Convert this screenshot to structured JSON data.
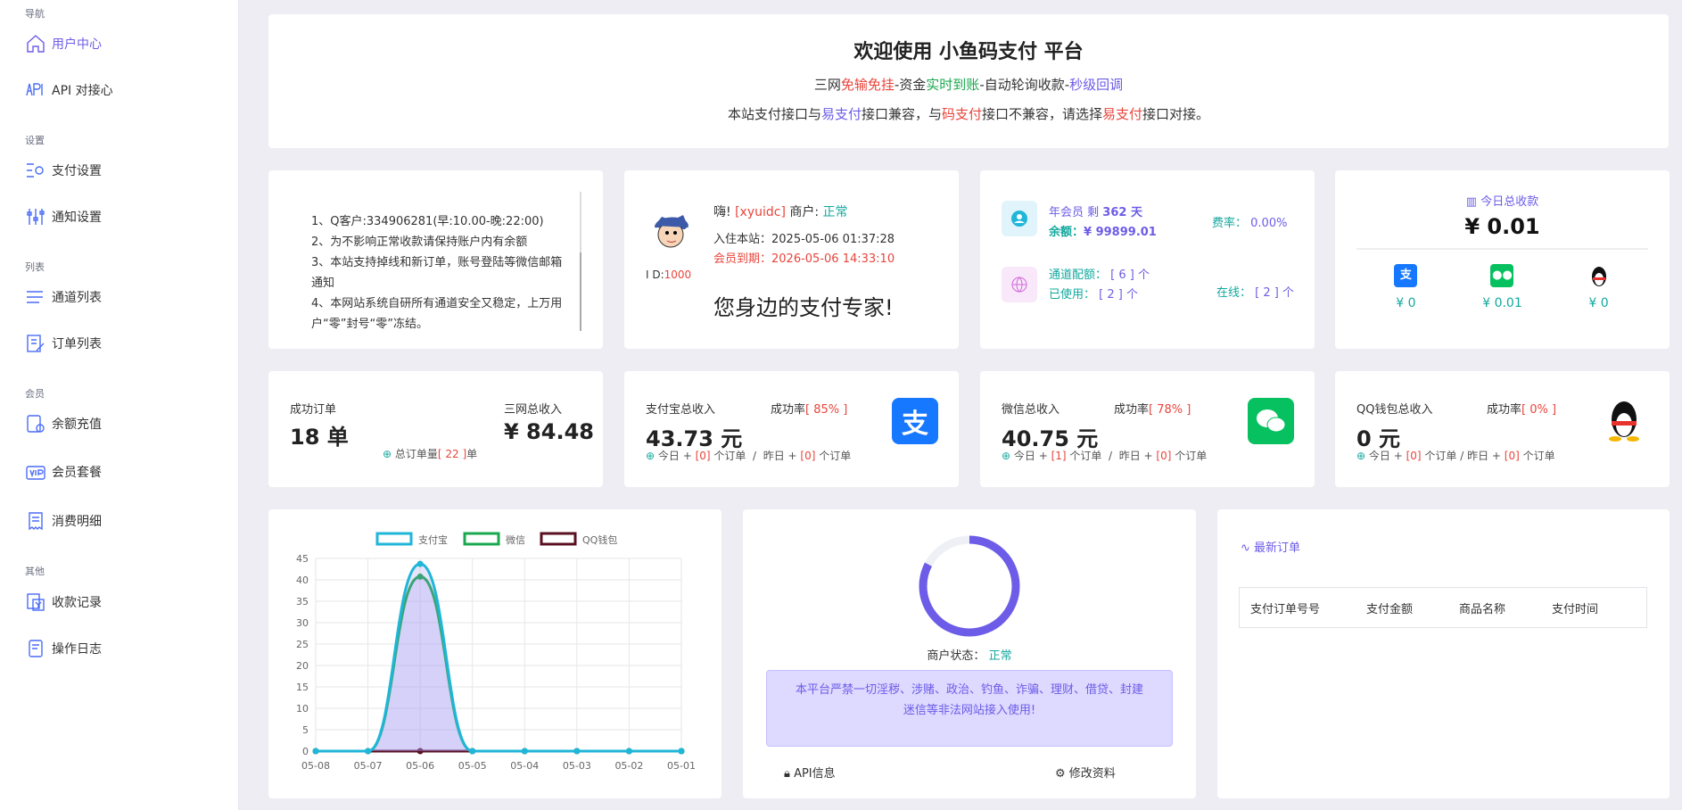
{
  "sidebar": {
    "sec_nav": "导航",
    "sec_settings": "设置",
    "sec_list": "列表",
    "sec_member": "会员",
    "sec_other": "其他",
    "items": [
      "用户中心",
      "API 对接心",
      "支付设置",
      "通知设置",
      "通道列表",
      "订单列表",
      "余额充值",
      "会员套餐",
      "消费明细",
      "收款记录",
      "操作日志"
    ]
  },
  "welcome": {
    "title": "欢迎使用 小鱼码支付 平台",
    "l1": [
      "三网",
      "免输免挂",
      "-资金",
      "实时到账",
      "-自动轮询收款-",
      "秒级回调"
    ],
    "l2": [
      "本站支付接口与",
      "易支付",
      "接口兼容，与",
      "码支付",
      "接口不兼容，请选择",
      "易支付",
      "接口对接。"
    ]
  },
  "notice": [
    "1、Q客户:334906281(早:10.00-晚:22:00)",
    "2、为不影响正常收款请保持账户内有余额",
    "3、本站支持掉线和新订单，账号登陆等微信邮箱通知",
    "4、本网站系统自研所有通道安全又稳定，上万用户“零”封号“零”冻结。"
  ],
  "user": {
    "greet": "嗨!",
    "name": "[xyuidc]",
    "merchant_lbl": "商户:",
    "merchant_status": "正常",
    "join": "入住本站：2025-05-06 01:37:28",
    "expire_lbl": "会员到期：",
    "expire": "2026-05-06 14:33:10",
    "id_lbl": "I D:",
    "id": "1000",
    "slogan": "您身边的支付专家!"
  },
  "member": {
    "vip": "年会员 剩",
    "days": "362 天",
    "balance_lbl": "余额：",
    "balance": "¥ 99899.01",
    "rate_lbl": "费率：",
    "rate": "0.00%",
    "ch_lbl": "通道配额：",
    "ch": "[ 6 ] 个",
    "used_lbl": "已使用：",
    "used": "[ 2 ] 个",
    "online_lbl": "在线：",
    "online": "[ 2 ] 个"
  },
  "today": {
    "title": "今日总收款",
    "total": "¥ 0.01",
    "ali": "¥ 0",
    "wx": "¥ 0.01",
    "qq": "¥ 0"
  },
  "stats": {
    "orders_lbl": "成功订单",
    "orders": "18 单",
    "income_lbl": "三网总收入",
    "income": "¥ 84.48",
    "total_lbl": "总订单量",
    "total": "[ 22 ]",
    "total_unit": "单",
    "ali": {
      "lbl": "支付宝总收入",
      "rate_lbl": "成功率",
      "rate": "[ 85% ]",
      "val": "43.73 元",
      "today": "[0]",
      "yest": "[0]"
    },
    "wx": {
      "lbl": "微信总收入",
      "rate_lbl": "成功率",
      "rate": "[ 78% ]",
      "val": "40.75 元",
      "today": "[1]",
      "yest": "[0]"
    },
    "qq": {
      "lbl": "QQ钱包总收入",
      "rate_lbl": "成功率",
      "rate": "[ 0% ]",
      "val": "0 元",
      "today": "[0]",
      "yest": "[0]"
    },
    "t_pre": "今日 + ",
    "t_suf": " 个订单",
    "y_pre": "昨日 + ",
    "y_suf": " 个订单"
  },
  "status": {
    "lbl": "商户状态：",
    "val": "正常",
    "warn": "本平台严禁一切淫秽、涉赌、政治、钓鱼、诈骗、理财、借贷、封建迷信等非法网站接入使用!",
    "api": "API信息",
    "edit": "修改资料"
  },
  "orders": {
    "title": "最新订单",
    "cols": [
      "支付订单号号",
      "支付金额",
      "商品名称",
      "支付时间"
    ]
  },
  "chart_data": {
    "type": "line",
    "categories": [
      "05-08",
      "05-07",
      "05-06",
      "05-05",
      "05-04",
      "05-03",
      "05-02",
      "05-01"
    ],
    "series": [
      {
        "name": "支付宝",
        "values": [
          0,
          0,
          43.73,
          0,
          0,
          0,
          0,
          0
        ],
        "color": "#1fb6d8"
      },
      {
        "name": "微信",
        "values": [
          0,
          0,
          40.75,
          0,
          0,
          0,
          0,
          0
        ],
        "color": "#1aa84f"
      },
      {
        "name": "QQ钱包",
        "values": [
          0,
          0,
          0,
          0,
          0,
          0,
          0,
          0
        ],
        "color": "#5a1020"
      }
    ],
    "ylim": [
      0,
      45
    ],
    "yticks": [
      0,
      5,
      10,
      15,
      20,
      25,
      30,
      35,
      40,
      45
    ],
    "grid": true,
    "legend": "top"
  }
}
